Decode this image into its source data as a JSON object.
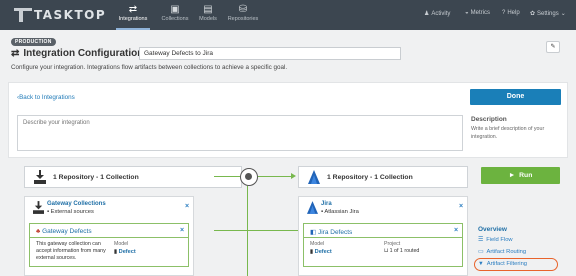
{
  "app": {
    "logo_text": "TASKTOP",
    "nav": [
      {
        "label": "Integrations",
        "icon": "integrations-icon",
        "active": true
      },
      {
        "label": "Collections",
        "icon": "collections-icon"
      },
      {
        "label": "Models",
        "icon": "models-icon"
      },
      {
        "label": "Repositories",
        "icon": "repositories-icon"
      }
    ],
    "right_nav": {
      "activity": "Activity",
      "metrics": "Metrics",
      "help": "Help",
      "settings": "Settings"
    }
  },
  "header": {
    "badge": "PRODUCTION",
    "title": "Integration Configuration",
    "name_value": "Gateway Defects to Jira",
    "description": "Configure your integration. Integrations flow artifacts between collections to achieve a specific goal."
  },
  "panel": {
    "back_link": "Back to Integrations",
    "done_label": "Done",
    "description_placeholder": "Describe your integration",
    "side_title": "Description",
    "side_text": "Write a brief description of your integration."
  },
  "flow": {
    "left_label": "1 Repository - 1 Collection",
    "right_label": "1 Repository - 1 Collection",
    "run_label": "Run"
  },
  "left_collection": {
    "name": "Gateway Collections",
    "sub": "External sources",
    "repo_name": "Gateway Defects",
    "repo_desc": "This gateway collection can accept information from many external sources.",
    "model_label": "Model",
    "model_value": "Defect"
  },
  "right_collection": {
    "name": "Jira",
    "sub": "Atlassian Jira",
    "repo_name": "Jira Defects",
    "model_label": "Model",
    "model_value": "Defect",
    "project_label": "Project",
    "project_value": "1 of 1 routed"
  },
  "overview": {
    "title": "Overview",
    "items": [
      "Field Flow",
      "Artifact Routing",
      "Artifact Filtering"
    ]
  },
  "colors": {
    "nav_bg": "#3c4650",
    "primary": "#1a7fb8",
    "run": "#6cb33f",
    "flow_line": "#78b84e",
    "highlight": "#e8632b"
  }
}
